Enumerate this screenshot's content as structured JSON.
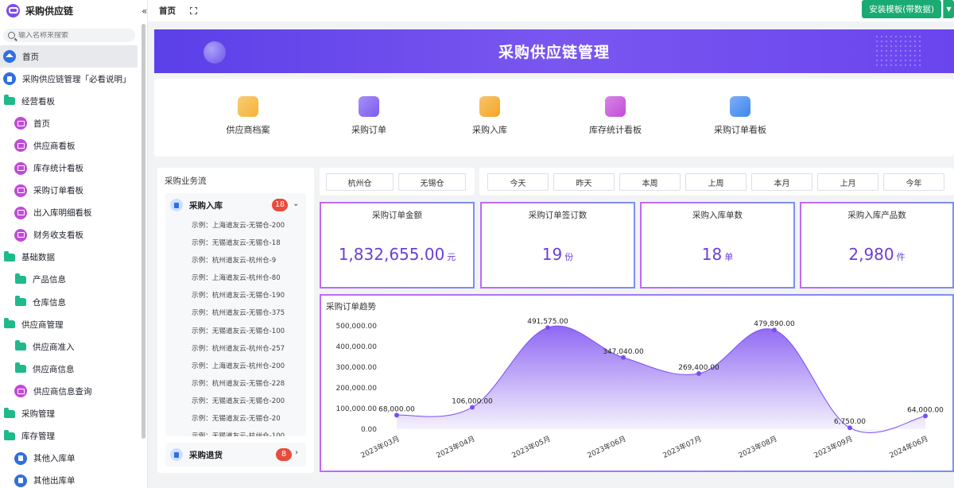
{
  "app": {
    "title": "采购供应链"
  },
  "search": {
    "placeholder": "输入名称来搜索"
  },
  "sidebar": {
    "items": [
      {
        "label": "首页",
        "icon": "home-icon",
        "level": 0,
        "active": true
      },
      {
        "label": "采购供应链管理「必看说明」",
        "icon": "document-icon",
        "level": 0
      },
      {
        "label": "经营看板",
        "icon": "folder-icon",
        "level": 0
      },
      {
        "label": "首页",
        "icon": "dashboard-icon",
        "level": 1
      },
      {
        "label": "供应商看板",
        "icon": "dashboard-icon",
        "level": 1
      },
      {
        "label": "库存统计看板",
        "icon": "dashboard-icon",
        "level": 1
      },
      {
        "label": "采购订单看板",
        "icon": "dashboard-icon",
        "level": 1
      },
      {
        "label": "出入库明细看板",
        "icon": "dashboard-icon",
        "level": 1
      },
      {
        "label": "财务收支看板",
        "icon": "dashboard-icon",
        "level": 1
      },
      {
        "label": "基础数据",
        "icon": "folder-icon",
        "level": 0
      },
      {
        "label": "产品信息",
        "icon": "folder-icon",
        "level": 1
      },
      {
        "label": "仓库信息",
        "icon": "folder-icon",
        "level": 1
      },
      {
        "label": "供应商管理",
        "icon": "folder-icon",
        "level": 0
      },
      {
        "label": "供应商准入",
        "icon": "folder-icon",
        "level": 1
      },
      {
        "label": "供应商信息",
        "icon": "folder-icon",
        "level": 1
      },
      {
        "label": "供应商信息查询",
        "icon": "dashboard-icon",
        "level": 1
      },
      {
        "label": "采购管理",
        "icon": "folder-icon",
        "level": 0
      },
      {
        "label": "库存管理",
        "icon": "folder-icon",
        "level": 0
      },
      {
        "label": "其他入库单",
        "icon": "document-icon",
        "level": 1
      },
      {
        "label": "其他出库单",
        "icon": "document-icon",
        "level": 1
      }
    ]
  },
  "topbar": {
    "breadcrumb": "首页",
    "install_label": "安装模板(带数据)"
  },
  "banner": {
    "title": "采购供应链管理"
  },
  "quick_entries": [
    {
      "label": "供应商档案",
      "icon": "supplier-folder-icon",
      "color": "#f5b335"
    },
    {
      "label": "采购订单",
      "icon": "cart-icon",
      "color": "#7b5af0"
    },
    {
      "label": "采购入库",
      "icon": "shield-check-icon",
      "color": "#f5a623"
    },
    {
      "label": "库存统计看板",
      "icon": "chart-circle-icon",
      "color": "#c34bd8"
    },
    {
      "label": "采购订单看板",
      "icon": "calendar-board-icon",
      "color": "#3d86f0"
    }
  ],
  "flow": {
    "title": "采购业务流",
    "inbound": {
      "label": "采购入库",
      "count": "18",
      "records": [
        "示例：上海道友云-无锡仓-200",
        "示例：无锡道友云-无锡仓-18",
        "示例：杭州道友云-杭州仓-9",
        "示例：上海道友云-杭州仓-80",
        "示例：杭州道友云-无锡仓-190",
        "示例：杭州道友云-无锡仓-375",
        "示例：无锡道友云-无锡仓-100",
        "示例：杭州道友云-杭州仓-257",
        "示例：上海道友云-杭州仓-200",
        "示例：杭州道友云-无锡仓-228",
        "示例：无锡道友云-无锡仓-200",
        "示例：无锡道友云-无锡仓-20",
        "示例：无锡道友云-杭州仓-100"
      ]
    },
    "returns": {
      "label": "采购退货",
      "count": "8"
    }
  },
  "warehouses": [
    "杭州仓",
    "无锡仓"
  ],
  "periods": [
    "今天",
    "昨天",
    "本周",
    "上周",
    "本月",
    "上月",
    "今年"
  ],
  "stats": [
    {
      "title": "采购订单金额",
      "value": "1,832,655.00",
      "unit": "元"
    },
    {
      "title": "采购订单签订数",
      "value": "19",
      "unit": "份"
    },
    {
      "title": "采购入库单数",
      "value": "18",
      "unit": "单"
    },
    {
      "title": "采购入库产品数",
      "value": "2,980",
      "unit": "件"
    }
  ],
  "chart_data": {
    "type": "area",
    "title": "采购订单趋势",
    "categories": [
      "2023年03月",
      "2023年04月",
      "2023年05月",
      "2023年06月",
      "2023年07月",
      "2023年08月",
      "2023年09月",
      "2024年06月"
    ],
    "values": [
      68000,
      106000,
      491575,
      347040,
      269400,
      479890,
      6750,
      64000
    ],
    "value_labels": [
      "68,000.00",
      "106,000.00",
      "491,575.00",
      "347,040.00",
      "269,400.00",
      "479,890.00",
      "6,750.00",
      "64,000.00"
    ],
    "y_ticks": [
      "0.00",
      "100,000.00",
      "200,000.00",
      "300,000.00",
      "400,000.00",
      "500,000.00"
    ],
    "ylim": [
      0,
      500000
    ],
    "color": "#7b4ef0",
    "grid": false
  }
}
